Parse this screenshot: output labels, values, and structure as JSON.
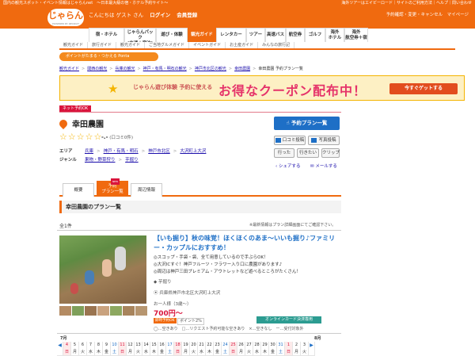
{
  "top_strip": {
    "left": "国内の観光スポット・イベント情報はじゃらんnet　～日本最大級の宿・ホテル予約サイト～",
    "right": "海外ツアーはエイビーロード｜サイトのご利用方法｜ヘルプ｜問い合わせ"
  },
  "header": {
    "logo": "じゃらん",
    "logo_sub": "POWERED BY RECRUIT",
    "greeting": "こんにちは ゲスト さん",
    "login": "ログイン",
    "register": "会員登録",
    "links": "予約確認・変更・キャンセル　マイページ"
  },
  "nav": {
    "items": [
      {
        "label": "宿・ホテル",
        "w": 45
      },
      {
        "label": "じゃらんパック\n(交通＋宿泊)",
        "w": 40,
        "two": true
      },
      {
        "label": "遊び・体験",
        "w": 40
      },
      {
        "label": "観光ガイド",
        "w": 36,
        "active": true
      },
      {
        "label": "レンタカー",
        "w": 38
      },
      {
        "label": "ツアー",
        "w": 24
      },
      {
        "label": "高速バス",
        "w": 26
      },
      {
        "label": "航空券",
        "w": 24
      },
      {
        "label": "ゴルフ",
        "w": 26
      },
      {
        "label": "海外\nホテル",
        "w": 24,
        "two": true
      },
      {
        "label": "海外\n航空券＋宿",
        "w": 30,
        "two": true
      }
    ]
  },
  "subnav": [
    "観光ガイド",
    "旅行ガイド",
    "観光ガイド",
    "ご当地グルメガイド",
    "イベントガイド",
    "お土産ガイド",
    "みんなの旅行記"
  ],
  "ponta_bar": "ポイントがたまる・つかえる Ponta",
  "breadcrumb": {
    "items": [
      "観光ガイド",
      "関西の観光",
      "兵庫の観光",
      "神戸・有馬・明石の観光",
      "神戸市北区の観光",
      "幸田農園"
    ],
    "current": "幸田農園 予約プラン一覧"
  },
  "banner": {
    "left": "じゃらん遊び体験 予約に使える",
    "main": "お得なクーポン配布中！",
    "button": "今すぐゲットする"
  },
  "net_tag": "ネット予約OK",
  "spot": {
    "title": "幸田農園",
    "stars": "☆☆☆☆☆",
    "score": "-.-",
    "reviews": "(口コミ0件)",
    "area_label": "エリア",
    "area": [
      "兵庫",
      "神戸・有馬・明石",
      "神戸市北区",
      "大沢町上大沢"
    ],
    "genre_label": "ジャンル",
    "genre": [
      "果物・野菜狩り",
      "芋掘り"
    ]
  },
  "side": {
    "plan_button": "予約プラン一覧",
    "review_post": "口コミ投稿",
    "photo_post": "写真投稿",
    "went": "行った",
    "want": "行きたい",
    "clip": "クリップ",
    "share": "シェアする",
    "mail": "メールする"
  },
  "tabs": {
    "overview": "概要",
    "plans": "予約\nプラン一覧",
    "nearby": "周辺情報",
    "badge": "NEW"
  },
  "section": {
    "title": "幸田農園のプラン一覧",
    "count": "全1件",
    "note": "※最新情報はプラン詳細画面にてご確認下さい。"
  },
  "plan": {
    "title": "【いも掘り】秋の味覚！ほくほくのあま～いいも掘り♪ファミリー・カップルにおすすめ！",
    "bullets": [
      "◎スコップ・手袋・袋、全て用意しているので手ぶらOK！",
      "◎大沢ICすぐ！神戸フルーツ・フラワー入り口に農園があります♪",
      "◎周辺は神戸三田プレミアム・アウトレットなど遊べるところがたくさん！"
    ],
    "category": "芋掘り",
    "address": "兵庫県神戸市北区大沢町上大沢",
    "per_person": "お一人様（3歳〜）",
    "price": "700円〜",
    "badge_fast": "即時予約OK",
    "points": "ポイント2%",
    "online_pay": "オンラインカード決済専用",
    "legend": "◯…空きあり　□…リクエスト予約可能な空きあり　×…空きなし　ー…受付対象外"
  },
  "calendar": {
    "month1": "7月",
    "month2": "8月",
    "days": [
      {
        "d": "",
        "w": ""
      },
      {
        "d": "4",
        "w": "日"
      },
      {
        "d": "5",
        "w": "月"
      },
      {
        "d": "6",
        "w": "火"
      },
      {
        "d": "7",
        "w": "水"
      },
      {
        "d": "8",
        "w": "木"
      },
      {
        "d": "9",
        "w": "金"
      },
      {
        "d": "10",
        "w": "土"
      },
      {
        "d": "11",
        "w": "日"
      },
      {
        "d": "12",
        "w": "月"
      },
      {
        "d": "13",
        "w": "火"
      },
      {
        "d": "14",
        "w": "水"
      },
      {
        "d": "15",
        "w": "木"
      },
      {
        "d": "16",
        "w": "金"
      },
      {
        "d": "17",
        "w": "土"
      },
      {
        "d": "18",
        "w": "日"
      },
      {
        "d": "19",
        "w": "月"
      },
      {
        "d": "20",
        "w": "火"
      },
      {
        "d": "21",
        "w": "水"
      },
      {
        "d": "22",
        "w": "木"
      },
      {
        "d": "23",
        "w": "金"
      },
      {
        "d": "24",
        "w": "土"
      },
      {
        "d": "25",
        "w": "日"
      },
      {
        "d": "26",
        "w": "月"
      },
      {
        "d": "27",
        "w": "火"
      },
      {
        "d": "28",
        "w": "水"
      },
      {
        "d": "29",
        "w": "木"
      },
      {
        "d": "30",
        "w": "金"
      },
      {
        "d": "31",
        "w": "土"
      },
      {
        "d": "1",
        "w": "日"
      },
      {
        "d": "2",
        "w": "月"
      },
      {
        "d": "3",
        "w": "火"
      },
      {
        "d": "",
        "w": ""
      }
    ]
  }
}
